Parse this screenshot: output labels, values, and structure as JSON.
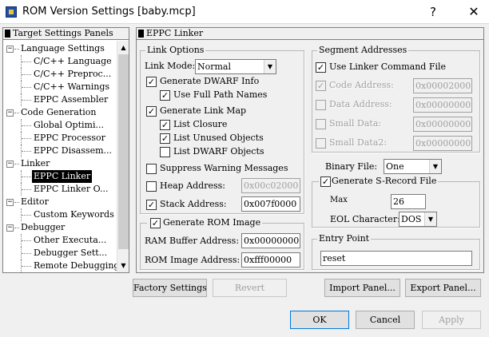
{
  "window": {
    "title": "ROM Version Settings [baby.mcp]",
    "help_glyph": "?",
    "close_glyph": "✕"
  },
  "tree": {
    "header": "Target Settings Panels",
    "items": [
      {
        "label": "Language Settings",
        "level": 0,
        "expander": "−"
      },
      {
        "label": "C/C++ Language",
        "level": 1
      },
      {
        "label": "C/C++ Preproc...",
        "level": 1
      },
      {
        "label": "C/C++ Warnings",
        "level": 1
      },
      {
        "label": "EPPC Assembler",
        "level": 1
      },
      {
        "label": "Code Generation",
        "level": 0,
        "expander": "−"
      },
      {
        "label": "Global Optimi...",
        "level": 1
      },
      {
        "label": "EPPC Processor",
        "level": 1
      },
      {
        "label": "EPPC Disassem...",
        "level": 1
      },
      {
        "label": "Linker",
        "level": 0,
        "expander": "−"
      },
      {
        "label": "EPPC Linker",
        "level": 1,
        "selected": true
      },
      {
        "label": "EPPC Linker O...",
        "level": 1
      },
      {
        "label": "Editor",
        "level": 0,
        "expander": "−"
      },
      {
        "label": "Custom Keywords",
        "level": 1
      },
      {
        "label": "Debugger",
        "level": 0,
        "expander": "−"
      },
      {
        "label": "Other Executa...",
        "level": 1
      },
      {
        "label": "Debugger Sett...",
        "level": 1
      },
      {
        "label": "Remote Debugging",
        "level": 1
      }
    ],
    "scroll_up": "▲",
    "scroll_down": "▼"
  },
  "panel": {
    "header": "EPPC Linker",
    "link_options": {
      "title": "Link Options",
      "link_mode_label": "Link Mode:",
      "link_mode_value": "Normal",
      "generate_dwarf": {
        "label": "Generate DWARF Info",
        "checked": "✓"
      },
      "use_full_path": {
        "label": "Use Full Path Names",
        "checked": "✓"
      },
      "generate_link_map": {
        "label": "Generate Link Map",
        "checked": "✓"
      },
      "list_closure": {
        "label": "List Closure",
        "checked": "✓"
      },
      "list_unused": {
        "label": "List Unused Objects",
        "checked": "✓"
      },
      "list_dwarf": {
        "label": "List DWARF Objects",
        "checked": ""
      },
      "suppress_warnings": {
        "label": "Suppress Warning Messages",
        "checked": ""
      },
      "heap_address": {
        "label": "Heap Address:",
        "checked": "",
        "value": "0x00c02000"
      },
      "stack_address": {
        "label": "Stack Address:",
        "checked": "✓",
        "value": "0x007f0000"
      }
    },
    "rom_image": {
      "title": "Generate ROM Image",
      "checked": "✓",
      "ram_buffer_label": "RAM Buffer Address:",
      "ram_buffer_value": "0x00000000",
      "rom_image_label": "ROM Image Address:",
      "rom_image_value": "0xfff00000"
    },
    "segments": {
      "title": "Segment Addresses",
      "use_linker_cmd": {
        "label": "Use Linker Command File",
        "checked": "✓"
      },
      "code_address": {
        "label": "Code Address:",
        "checked": "✓",
        "value": "0x00002000"
      },
      "data_address": {
        "label": "Data Address:",
        "checked": "",
        "value": "0x00000000"
      },
      "small_data": {
        "label": "Small Data:",
        "checked": "",
        "value": "0x00000000"
      },
      "small_data2": {
        "label": "Small Data2:",
        "checked": "",
        "value": "0x00000000"
      }
    },
    "binary_file_label": "Binary File:",
    "binary_file_value": "One",
    "srecord": {
      "title": "Generate S-Record File",
      "checked": "✓",
      "max_label": "Max",
      "max_value": "26",
      "eol_label": "EOL Character:",
      "eol_value": "DOS"
    },
    "entry_point": {
      "title": "Entry Point",
      "value": "reset"
    },
    "dropdown_arrow": "▼"
  },
  "panel_buttons": {
    "factory": "Factory Settings",
    "revert": "Revert",
    "import": "Import Panel...",
    "export": "Export Panel..."
  },
  "dialog_buttons": {
    "ok": "OK",
    "cancel": "Cancel",
    "apply": "Apply"
  }
}
